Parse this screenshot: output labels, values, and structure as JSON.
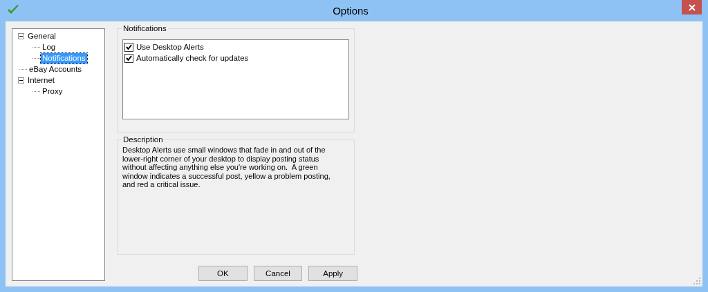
{
  "window": {
    "title": "Options"
  },
  "tree": [
    {
      "label": "General",
      "expanded": true,
      "selected": false,
      "children": [
        {
          "label": "Log",
          "selected": false
        },
        {
          "label": "Notifications",
          "selected": true
        }
      ]
    },
    {
      "label": "eBay Accounts",
      "selected": false
    },
    {
      "label": "Internet",
      "expanded": true,
      "selected": false,
      "children": [
        {
          "label": "Proxy",
          "selected": false
        }
      ]
    }
  ],
  "notifications": {
    "title": "Notifications",
    "options": [
      {
        "label": "Use Desktop Alerts",
        "checked": true
      },
      {
        "label": "Automatically check for updates",
        "checked": true
      }
    ]
  },
  "description": {
    "title": "Description",
    "text": "Desktop Alerts use small windows that fade in and out of the lower-right corner of your desktop to display posting status without affecting anything else you're working on.  A green window indicates a successful post, yellow a problem posting, and red a critical issue."
  },
  "buttons": [
    "OK",
    "Cancel",
    "Apply"
  ]
}
